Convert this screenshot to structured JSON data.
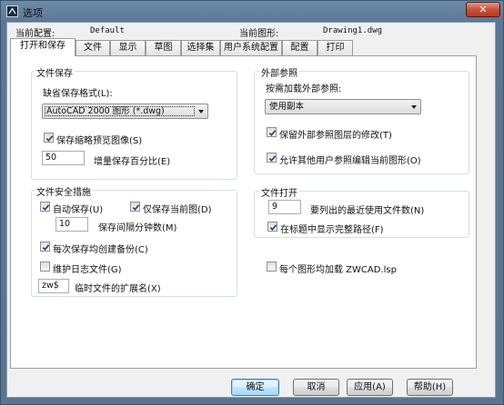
{
  "window": {
    "title": "选项",
    "close_glyph": "✕"
  },
  "profile": {
    "current_config_label": "当前配置:",
    "current_config_value": "Default",
    "current_drawing_label": "当前图形:",
    "current_drawing_value": "Drawing1.dwg"
  },
  "tabs": [
    "打开和保存",
    "文件",
    "显示",
    "草图",
    "选择集",
    "用户系统配置",
    "配置",
    "打印"
  ],
  "file_save": {
    "group_title": "文件保存",
    "format_label": "缺省保存格式(L):",
    "format_value": "AutoCAD 2000 图形 (*.dwg)",
    "thumbnail_label": "保存缩略预览图像(S)",
    "thumbnail_checked": true,
    "incremental_value": "50",
    "incremental_label": "增量保存百分比(E)"
  },
  "xref": {
    "group_title": "外部参照",
    "demand_label": "按需加载外部参照:",
    "demand_value": "使用副本",
    "retain_changes_label": "保留外部参照图层的修改(T)",
    "retain_changes_checked": true,
    "allow_edit_label": "允许其他用户参照编辑当前图形(O)",
    "allow_edit_checked": true
  },
  "safety": {
    "group_title": "文件安全措施",
    "autosave_label": "自动保存(U)",
    "autosave_checked": true,
    "autosave_current_label": "仅保存当前图(D)",
    "autosave_current_checked": true,
    "minutes_value": "10",
    "minutes_label": "保存间隔分钟数(M)",
    "backup_label": "每次保存均创建备份(C)",
    "backup_checked": true,
    "log_label": "维护日志文件(G)",
    "log_checked": false,
    "temp_ext_value": "zw$",
    "temp_ext_label": "临时文件的扩展名(X)"
  },
  "file_open": {
    "group_title": "文件打开",
    "recent_value": "9",
    "recent_label": "要列出的最近使用文件数(N)",
    "full_path_label": "在标题中显示完整路径(F)",
    "full_path_checked": true
  },
  "lsp": {
    "label": "每个图形均加载 ZWCAD.lsp",
    "checked": false
  },
  "buttons": {
    "ok": "确定",
    "cancel": "取消",
    "apply": "应用(A)",
    "help": "帮助(H)"
  }
}
